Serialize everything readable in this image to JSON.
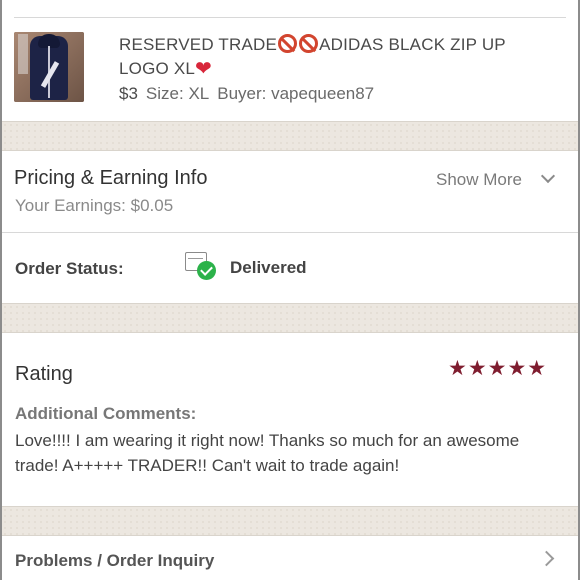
{
  "listing": {
    "title_part1": "RESERVED TRADE",
    "title_part2": "ADIDAS BLACK ZIP UP LOGO XL",
    "no_icon_1": "no-entry-icon",
    "no_icon_2": "no-entry-icon",
    "heart_icon": "❤",
    "price": "$3",
    "size": "Size: XL",
    "buyer": "Buyer: vapequeen87"
  },
  "pricing": {
    "title": "Pricing & Earning Info",
    "earnings": "Your Earnings: $0.05",
    "show_more_label": "Show More"
  },
  "order_status": {
    "label": "Order Status:",
    "value": "Delivered"
  },
  "rating": {
    "title": "Rating",
    "stars": "★★★★★",
    "star_count": 5,
    "comments_label": "Additional Comments:",
    "comments_text": "Love!!!! I am wearing it right now! Thanks so much for an awesome trade! A+++++ TRADER!! Can't wait to trade again!"
  },
  "problems": {
    "label": "Problems / Order Inquiry"
  },
  "colors": {
    "star": "#7f1d2f",
    "delivered_check": "#2cb24a",
    "band_bg": "#ece7e0"
  }
}
